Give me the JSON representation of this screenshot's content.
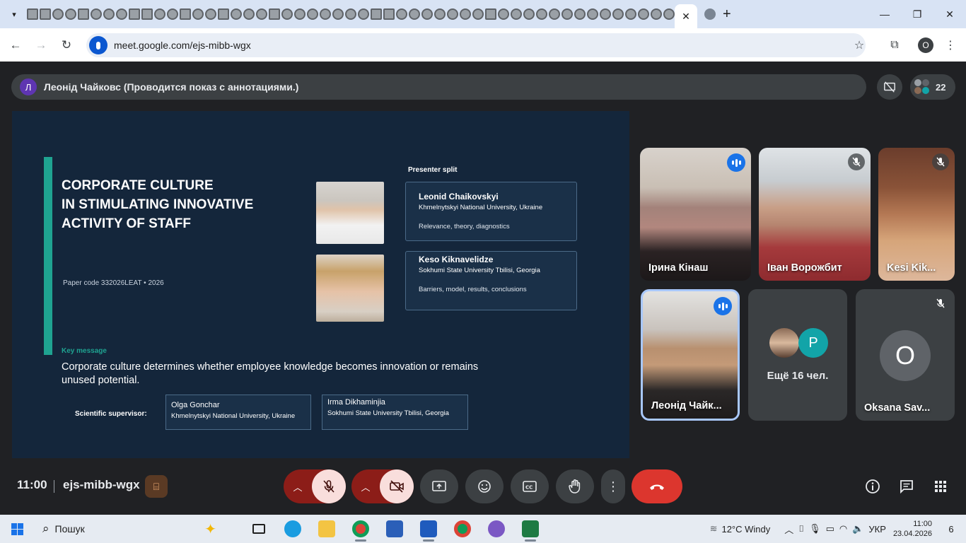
{
  "browser": {
    "url": "meet.google.com/ejs-mibb-wgx",
    "active_tab_close": "✕",
    "new_tab": "+",
    "profile_initial": "О",
    "window_controls": [
      "—",
      "❐",
      "✕"
    ]
  },
  "meet": {
    "presenter_avatar": "Л",
    "presenter_text": "Леонід Чайковс (Проводится показ с аннотациями.)",
    "participant_count": "22",
    "meeting_time": "11:00",
    "meeting_code": "ejs-mibb-wgx",
    "tiles": [
      {
        "name": "Ірина Кінаш",
        "status": "speaking"
      },
      {
        "name": "Іван Ворожбит",
        "status": "muted"
      },
      {
        "name": "Kesi Kik...",
        "status": "muted"
      },
      {
        "name": "Леонід Чайк...",
        "status": "speaking"
      },
      {
        "name": "Ещё 16 чел.",
        "avatar_letter": "P",
        "status": "none"
      },
      {
        "name": "Oksana Sav...",
        "avatar_letter": "O",
        "status": "muted"
      }
    ]
  },
  "slide": {
    "title_lines": [
      "CORPORATE CULTURE",
      "IN STIMULATING INNOVATIVE",
      "ACTIVITY OF STAFF"
    ],
    "paper_code": "Paper code 332026LEAT  •  2026",
    "presenter_split_label": "Presenter split",
    "presenters": [
      {
        "name": "Leonid Chaikovskyi",
        "affiliation": "Khmelnytskyi National University, Ukraine",
        "topic": "Relevance, theory, diagnostics"
      },
      {
        "name": "Keso Kiknavelidze",
        "affiliation": "Sokhumi State University Tbilisi, Georgia",
        "topic": "Barriers, model, results, conclusions"
      }
    ],
    "key_message_label": "Key message",
    "key_message": "Corporate culture determines whether employee knowledge becomes innovation or remains unused potential.",
    "supervisor_label": "Scientific supervisor:",
    "supervisors": [
      {
        "name": "Olga Gonchar",
        "affiliation": "Khmelnytskyi National University, Ukraine"
      },
      {
        "name": "Irma Dikhaminjia",
        "affiliation": "Sokhumi State University Tbilisi, Georgia"
      }
    ]
  },
  "taskbar": {
    "search_label": "Пошук",
    "weather": "12°C  Windy",
    "language": "УКР",
    "time": "11:00",
    "date": "23.04.2026",
    "notification_count": "6"
  },
  "colors": {
    "slide_bg": "#14263b",
    "accent_teal": "#1fa391",
    "end_call": "#dc362e",
    "speaking_blue": "#1a73e8"
  },
  "icons": [
    "mic-off-icon",
    "camera-off-icon",
    "present-icon",
    "emoji-icon",
    "captions-icon",
    "raise-hand-icon",
    "more-options-icon",
    "end-call-icon",
    "info-icon",
    "chat-icon",
    "activities-icon"
  ]
}
